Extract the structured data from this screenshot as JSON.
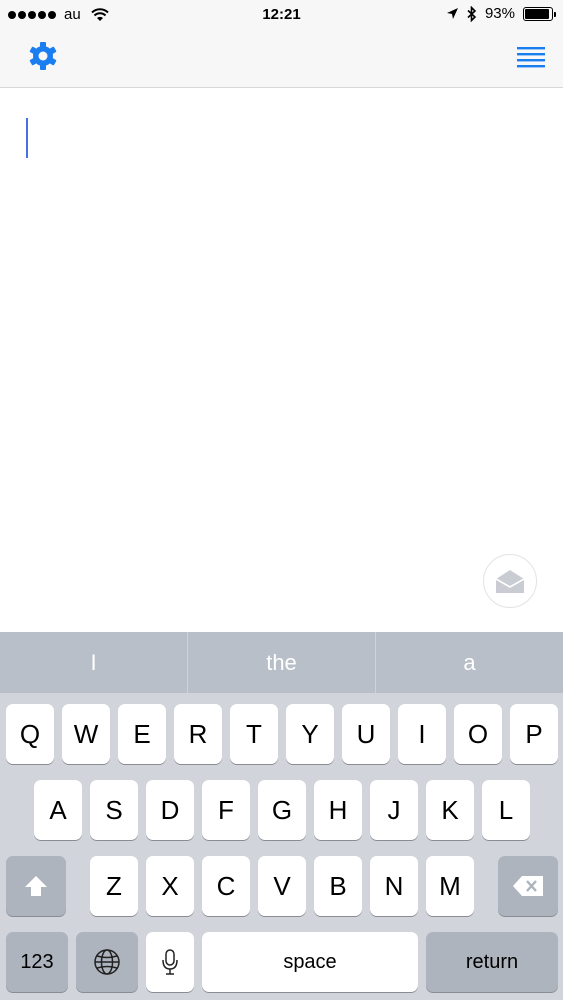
{
  "status_bar": {
    "carrier": "au",
    "time": "12:21",
    "battery_percent": "93%",
    "battery_level": 0.93,
    "signal_dots_filled": 5,
    "icons": [
      "wifi-icon",
      "location-arrow-icon",
      "bluetooth-icon",
      "battery-icon"
    ]
  },
  "nav_bar": {
    "left_icon": "gear-icon",
    "right_icon": "list-icon",
    "accent_color": "#1a7ef0"
  },
  "editor": {
    "text": "",
    "cursor_color": "#4a6fe3",
    "send_icon": "envelope-open-icon"
  },
  "keyboard": {
    "suggestions": [
      "I",
      "the",
      "a"
    ],
    "rows": [
      [
        "Q",
        "W",
        "E",
        "R",
        "T",
        "Y",
        "U",
        "I",
        "O",
        "P"
      ],
      [
        "A",
        "S",
        "D",
        "F",
        "G",
        "H",
        "J",
        "K",
        "L"
      ],
      [
        "Z",
        "X",
        "C",
        "V",
        "B",
        "N",
        "M"
      ]
    ],
    "numbers_label": "123",
    "space_label": "space",
    "return_label": "return",
    "shift_icon": "shift-icon",
    "backspace_icon": "backspace-icon",
    "globe_icon": "globe-icon",
    "mic_icon": "microphone-icon"
  }
}
